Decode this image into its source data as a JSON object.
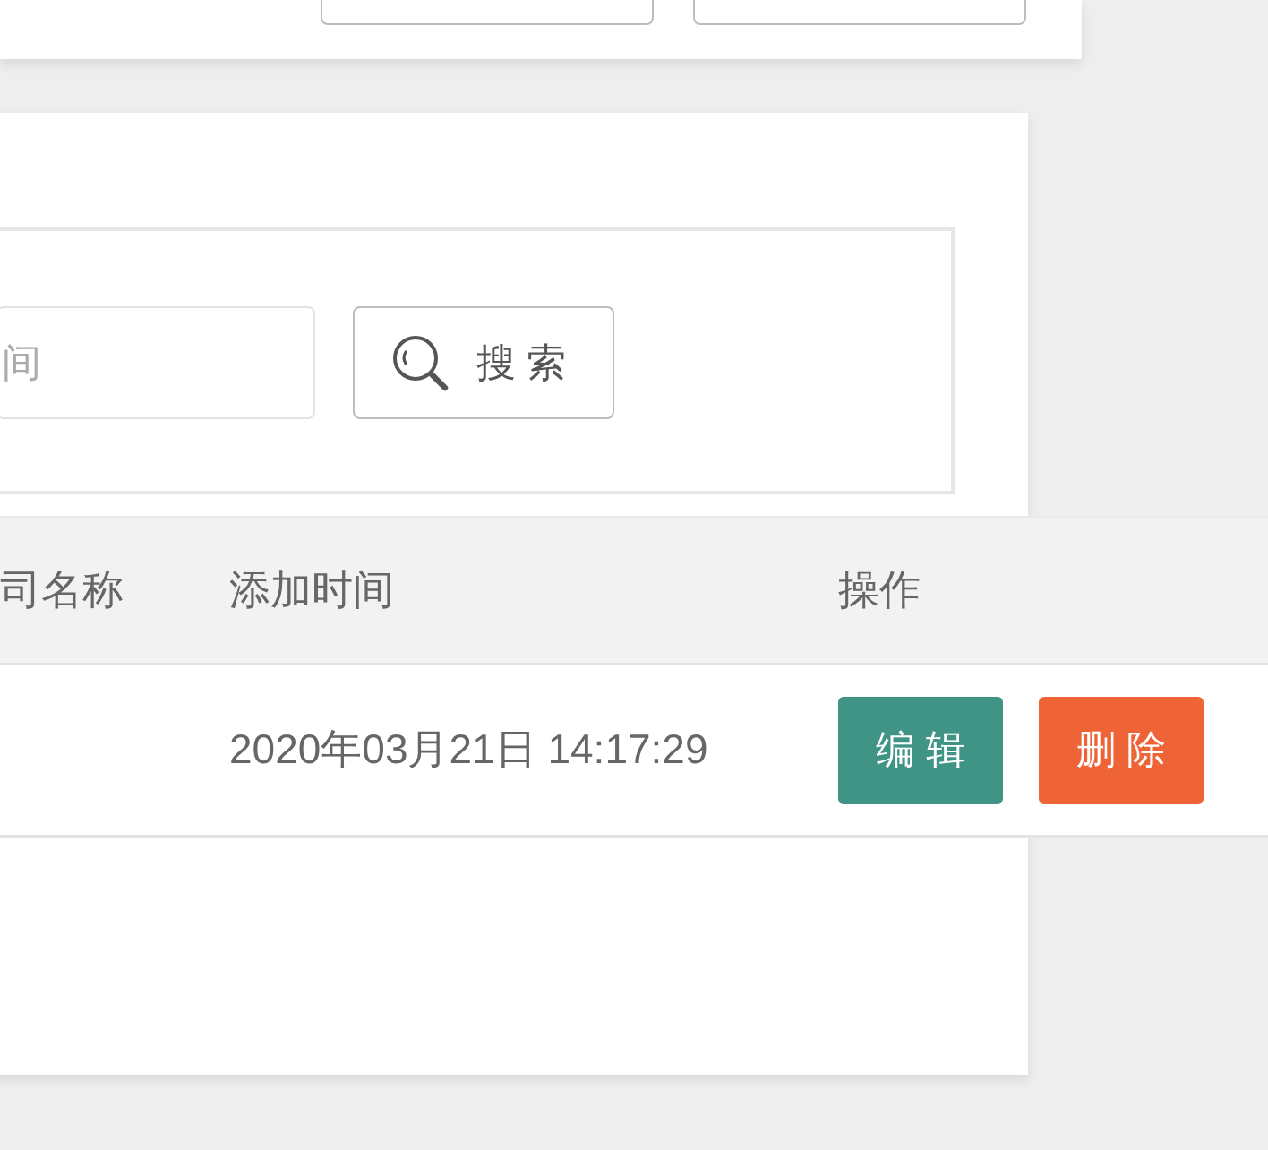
{
  "top_panel": {
    "buttons": [
      {
        "kind": "outline"
      },
      {
        "kind": "outline"
      }
    ]
  },
  "search_panel": {
    "field": {
      "placeholder": "间"
    },
    "search_button": {
      "label": "搜 索"
    }
  },
  "table": {
    "columns": [
      "司名称",
      "添加时间",
      "操作"
    ],
    "rows": [
      {
        "added_time": "2020年03月21日 14:17:29",
        "actions": [
          {
            "kind": "edit",
            "label": "编 辑"
          },
          {
            "kind": "delete",
            "label": "删 除"
          }
        ]
      }
    ]
  }
}
